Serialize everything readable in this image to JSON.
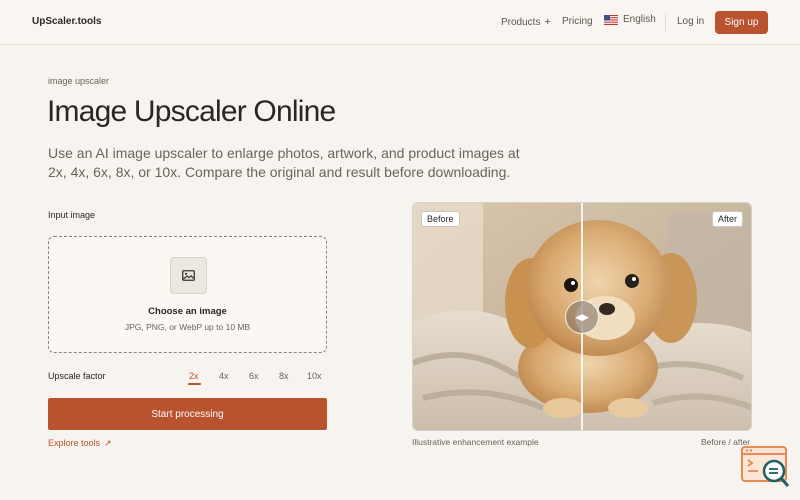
{
  "header": {
    "logo": "UpScaler.tools",
    "nav": {
      "products": "Products",
      "products_suffix": "+",
      "pricing": "Pricing",
      "language": "English",
      "login": "Log in",
      "signup": "Sign up"
    }
  },
  "hero": {
    "eyebrow": "image upscaler",
    "title": "Image Upscaler Online",
    "subtitle": "Use an AI image upscaler to enlarge photos, artwork, and product images at 2x, 4x, 6x, 8x, or 10x. Compare the original and result before downloading."
  },
  "form": {
    "input_label": "Input image",
    "dropzone_title": "Choose an image",
    "dropzone_hint": "JPG, PNG, or WebP up to 10 MB",
    "scale_label": "Upscale factor",
    "scale_options": [
      "2x",
      "4x",
      "6x",
      "8x",
      "10x"
    ],
    "selected_scale": "2x",
    "start_button": "Start processing",
    "explore_link": "Explore tools",
    "explore_arrow": "↗"
  },
  "compare": {
    "before_tag": "Before",
    "after_tag": "After",
    "handle_glyph": "◀▶",
    "caption": "Illustrative enhancement example",
    "caption_right": "Before / after"
  },
  "colors": {
    "accent": "#b9522f",
    "background": "#f7f3ee",
    "text": "#2b2622",
    "muted": "#6b635c"
  },
  "icons": {
    "dropzone": "image-icon",
    "flag": "us-flag-icon",
    "helper": "search-console-icon"
  }
}
